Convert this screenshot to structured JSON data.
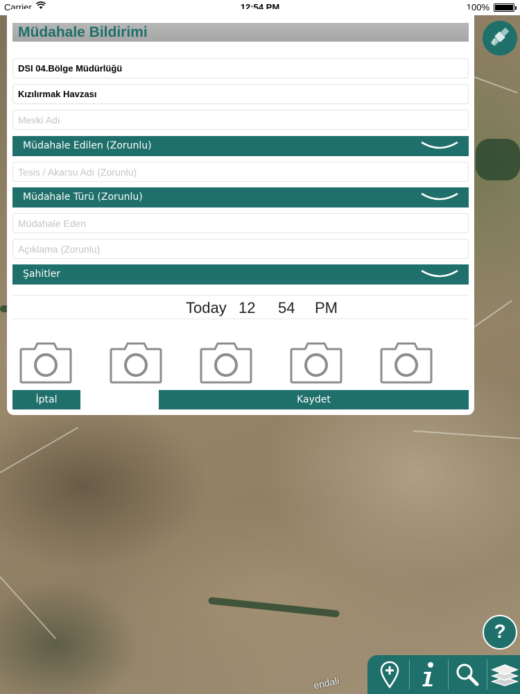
{
  "status_bar": {
    "carrier": "Carrier",
    "time": "12:54 PM",
    "battery": "100%"
  },
  "form": {
    "title": "Müdahale Bildirimi",
    "region_value": "DSI 04.Bölge Müdürlüğü",
    "basin_value": "Kızılırmak Havzası",
    "location_placeholder": "Mevki Adı",
    "intervened_dropdown": "Müdahale Edilen (Zorunlu)",
    "facility_placeholder": "Tesis / Akarsu Adı (Zorunlu)",
    "type_dropdown": "Müdahale Türü (Zorunlu)",
    "intervener_placeholder": "Müdahale Eden",
    "description_placeholder": "Açıklama (Zorunlu)",
    "witnesses_dropdown": "Şahitler",
    "time_picker": {
      "day": "Today",
      "hour": "12",
      "minute": "54",
      "period": "PM"
    },
    "cancel_label": "İptal",
    "save_label": "Kaydet"
  },
  "map": {
    "help_label": "?",
    "road_label": "endali"
  },
  "colors": {
    "accent": "#1f6f6a",
    "title_bar": "#aaaaaa"
  },
  "icons": {
    "satellite": "satellite-icon",
    "camera": "camera-icon",
    "add_pin": "add-pin-icon",
    "info": "info-icon",
    "search": "search-icon",
    "layers": "layers-icon"
  }
}
